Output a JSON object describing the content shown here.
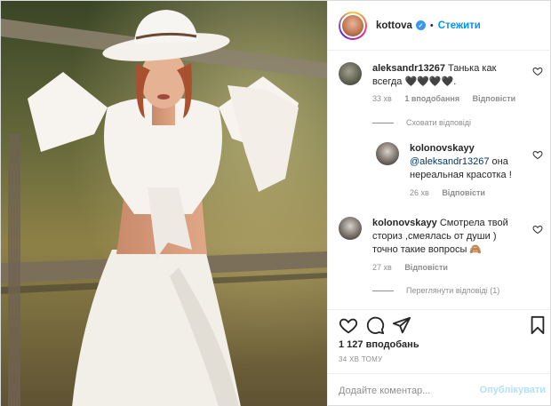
{
  "post": {
    "author": "kottova",
    "follow_label": "Стежити",
    "separator": "•"
  },
  "comments": [
    {
      "user": "aleksandr13267",
      "text": "Танька как всегда 🖤🖤🖤🖤.",
      "time": "33 хв",
      "likes": "1 вподобання",
      "reply": "Відповісти",
      "thread_toggle": "Сховати відповіді"
    },
    {
      "user": "kolonovskayy",
      "mention": "@aleksandr13267",
      "text": "она нереальная красотка !",
      "time": "26 хв",
      "reply": "Відповісти"
    },
    {
      "user": "kolonovskayy",
      "text": "Смотрела твой сториз ,смеялась от души ) точно такие вопросы 🙈",
      "time": "27 хв",
      "reply": "Відповісти",
      "thread_toggle": "Переглянути відповіді (1)"
    }
  ],
  "footer": {
    "likes_count": "1 127 вподобань",
    "time_ago": "34 ХВ ТОМУ",
    "comment_placeholder": "Додайте коментар...",
    "publish_label": "Опублікувати"
  },
  "icons": [
    "verified-icon",
    "heart-icon",
    "comment-icon",
    "share-icon",
    "bookmark-icon"
  ],
  "colors": {
    "link_blue": "#0095f6",
    "verified_blue": "#3897f0",
    "muted": "#8e8e8e",
    "publish_disabled": "#b2dffc"
  }
}
